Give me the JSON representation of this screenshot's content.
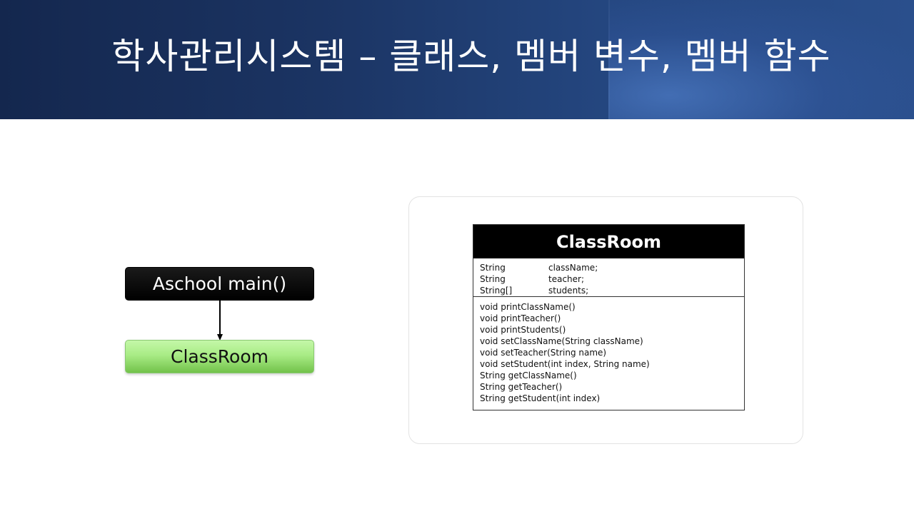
{
  "slide": {
    "title": "학사관리시스템 – 클래스, 멤버 변수, 멤버 함수"
  },
  "flow": {
    "top_box": "Aschool main()",
    "bottom_box": "ClassRoom"
  },
  "uml": {
    "class_name": "ClassRoom",
    "fields": [
      {
        "type": "String",
        "name": "className;"
      },
      {
        "type": "String",
        "name": "teacher;"
      },
      {
        "type": "String[]",
        "name": "students;"
      }
    ],
    "methods": [
      "void printClassName()",
      "void printTeacher()",
      "void printStudents()",
      "void setClassName(String className)",
      "void setTeacher(String name)",
      "void setStudent(int index, String name)",
      "String getClassName()",
      "String getTeacher()",
      "String getStudent(int index)"
    ]
  },
  "colors": {
    "header_dark": "#14274e",
    "header_light": "#2a4f8c",
    "green_box": "#a9ec86",
    "black_box": "#000000"
  }
}
